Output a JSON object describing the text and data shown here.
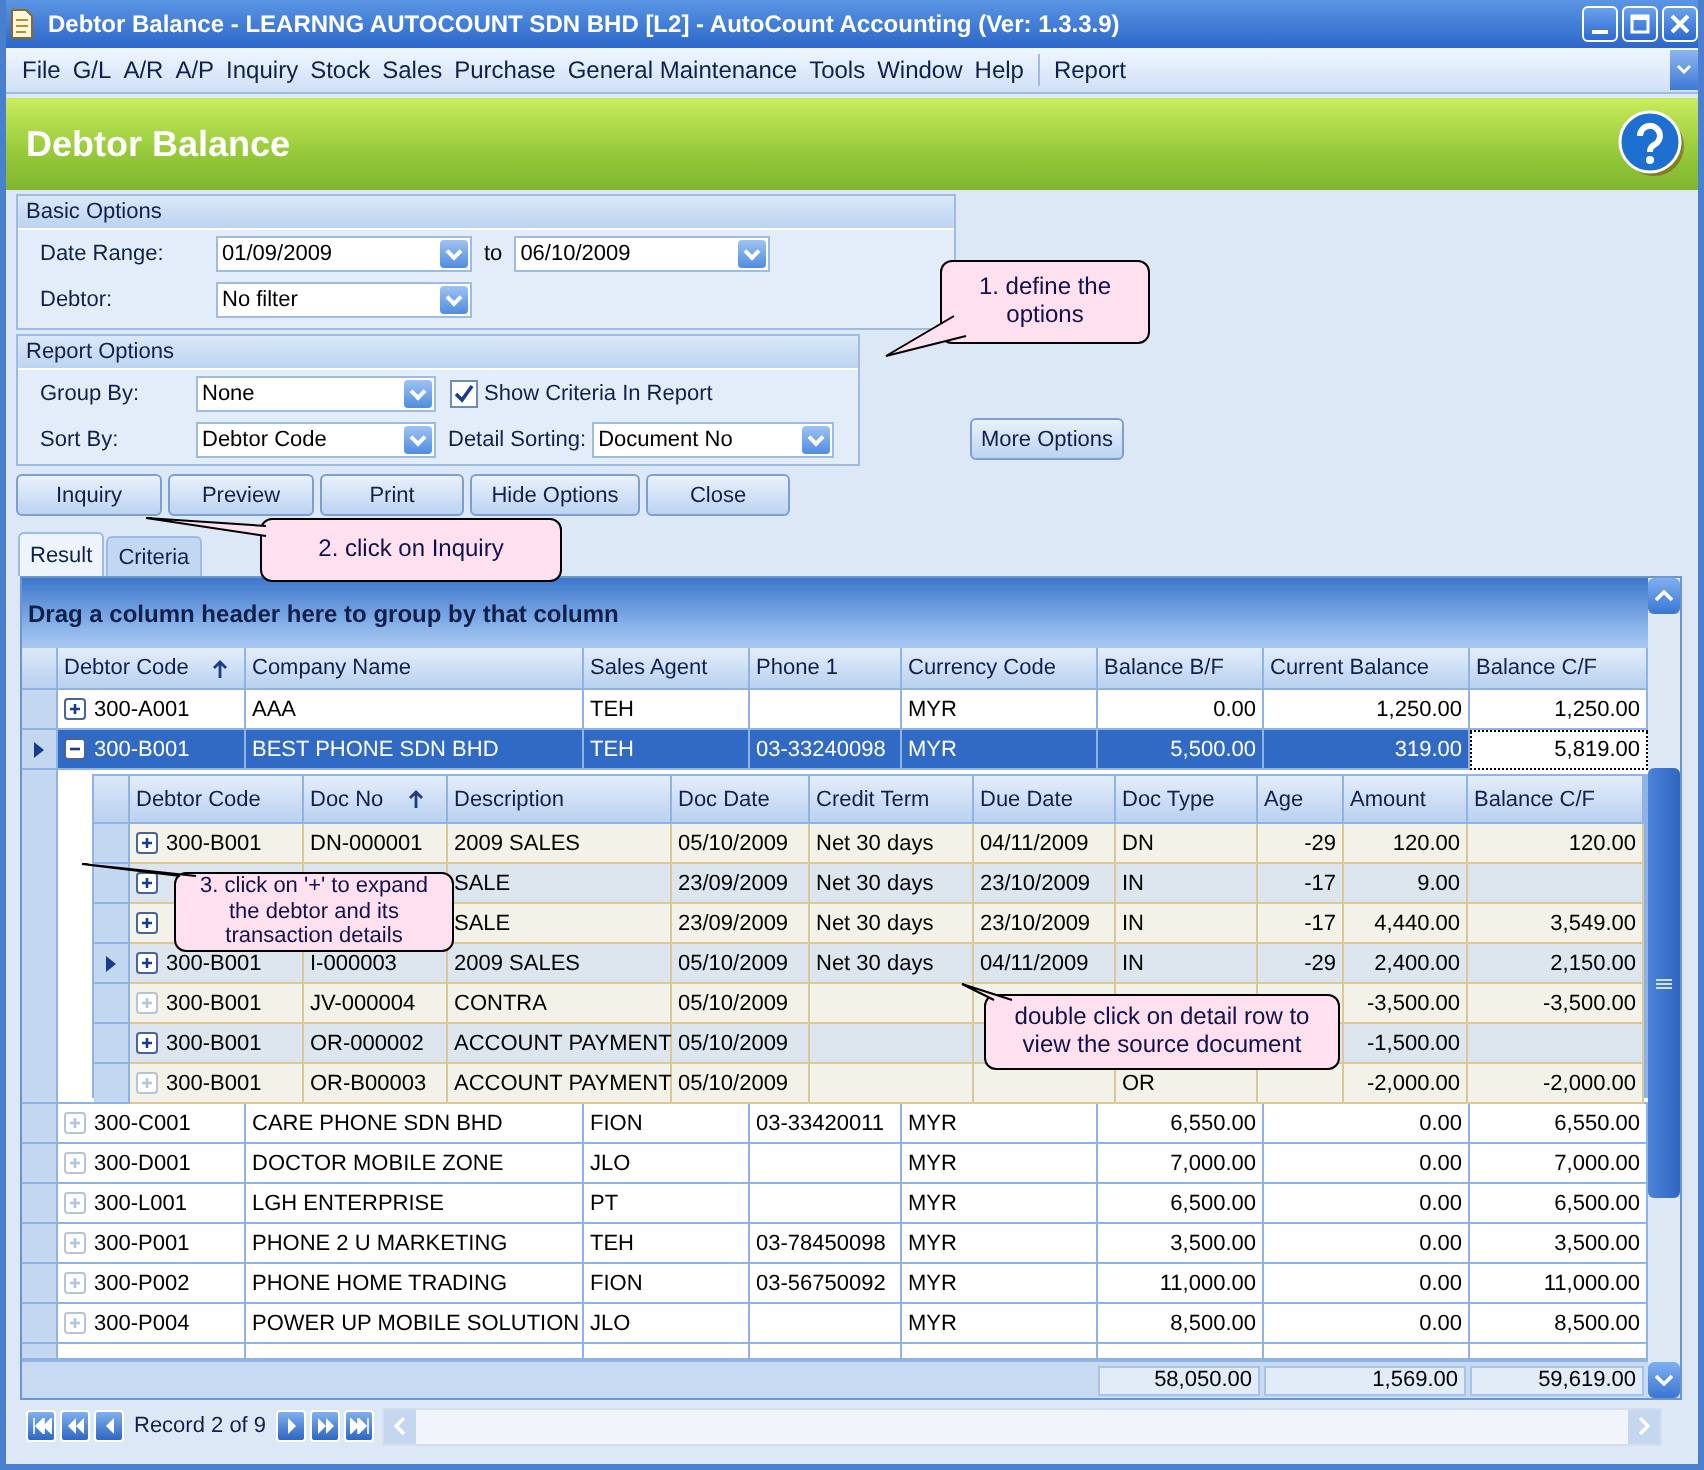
{
  "window": {
    "title": "Debtor Balance - LEARNNG AUTOCOUNT SDN BHD [L2] - AutoCount Accounting (Ver: 1.3.3.9)"
  },
  "menu": [
    "File",
    "G/L",
    "A/R",
    "A/P",
    "Inquiry",
    "Stock",
    "Sales",
    "Purchase",
    "General Maintenance",
    "Tools",
    "Window",
    "Help",
    "Report"
  ],
  "header": {
    "title": "Debtor Balance"
  },
  "basic_options": {
    "title": "Basic Options",
    "date_label": "Date Range:",
    "date_from": "01/09/2009",
    "date_separator": "to",
    "date_to": "06/10/2009",
    "debtor_label": "Debtor:",
    "debtor_value": "No filter"
  },
  "report_options": {
    "title": "Report Options",
    "group_label": "Group By:",
    "group_value": "None",
    "show_criteria": {
      "label": "Show Criteria In Report",
      "checked": true
    },
    "sort_label": "Sort By:",
    "sort_value": "Debtor Code",
    "detail_label": "Detail Sorting:",
    "detail_value": "Document No"
  },
  "more_options": "More Options",
  "buttons": [
    "Inquiry",
    "Preview",
    "Print",
    "Hide Options",
    "Close"
  ],
  "tabs": [
    {
      "label": "Result",
      "selected": true
    },
    {
      "label": "Criteria",
      "selected": false
    }
  ],
  "grid": {
    "group_hint": "Drag a column header here to group by that column",
    "columns": [
      "Debtor Code",
      "Company Name",
      "Sales Agent",
      "Phone 1",
      "Currency Code",
      "Balance B/F",
      "Current Balance",
      "Balance C/F"
    ],
    "rows_before": [
      {
        "cells": [
          "300-A001",
          "AAA",
          "TEH",
          "",
          "MYR",
          "0.00",
          "1,250.00",
          "1,250.00"
        ],
        "expanded": false,
        "has_details": true,
        "selected": false
      },
      {
        "cells": [
          "300-B001",
          "BEST PHONE SDN BHD",
          "TEH",
          "03-33240098",
          "MYR",
          "5,500.00",
          "319.00",
          "5,819.00"
        ],
        "expanded": true,
        "has_details": true,
        "selected": true
      }
    ],
    "detail": {
      "columns": [
        "Debtor Code",
        "Doc No",
        "Description",
        "Doc Date",
        "Credit Term",
        "Due Date",
        "Doc Type",
        "Age",
        "Amount",
        "Balance C/F"
      ],
      "rows": [
        {
          "cells": [
            "300-B001",
            "DN-000001",
            "2009 SALES",
            "05/10/2009",
            "Net 30 days",
            "04/11/2009",
            "DN",
            "-29",
            "120.00",
            "120.00"
          ],
          "has_details": true,
          "current": false
        },
        {
          "cells": [
            "",
            "",
            "SALE",
            "23/09/2009",
            "Net 30 days",
            "23/10/2009",
            "IN",
            "-17",
            "9.00",
            ""
          ],
          "has_details": true,
          "current": false
        },
        {
          "cells": [
            "",
            "",
            "SALE",
            "23/09/2009",
            "Net 30 days",
            "23/10/2009",
            "IN",
            "-17",
            "4,440.00",
            "3,549.00"
          ],
          "has_details": true,
          "current": false
        },
        {
          "cells": [
            "300-B001",
            "I-000003",
            "2009 SALES",
            "05/10/2009",
            "Net 30 days",
            "04/11/2009",
            "IN",
            "-29",
            "2,400.00",
            "2,150.00"
          ],
          "has_details": true,
          "current": true
        },
        {
          "cells": [
            "300-B001",
            "JV-000004",
            "CONTRA",
            "05/10/2009",
            "",
            "",
            "",
            "",
            "-3,500.00",
            "-3,500.00"
          ],
          "has_details": false,
          "current": false
        },
        {
          "cells": [
            "300-B001",
            "OR-000002",
            "ACCOUNT PAYMENT",
            "05/10/2009",
            "",
            "",
            "",
            "",
            "-1,500.00",
            ""
          ],
          "has_details": true,
          "current": false
        },
        {
          "cells": [
            "300-B001",
            "OR-B00003",
            "ACCOUNT PAYMENT",
            "05/10/2009",
            "",
            "",
            "OR",
            "",
            "-2,000.00",
            "-2,000.00"
          ],
          "has_details": false,
          "current": false
        }
      ]
    },
    "rows_after": [
      {
        "cells": [
          "300-C001",
          "CARE PHONE SDN BHD",
          "FION",
          "03-33420011",
          "MYR",
          "6,550.00",
          "0.00",
          "6,550.00"
        ],
        "expanded": false,
        "has_details": false,
        "selected": false
      },
      {
        "cells": [
          "300-D001",
          "DOCTOR MOBILE ZONE",
          "JLO",
          "",
          "MYR",
          "7,000.00",
          "0.00",
          "7,000.00"
        ],
        "expanded": false,
        "has_details": false,
        "selected": false
      },
      {
        "cells": [
          "300-L001",
          "LGH ENTERPRISE",
          "PT",
          "",
          "MYR",
          "6,500.00",
          "0.00",
          "6,500.00"
        ],
        "expanded": false,
        "has_details": false,
        "selected": false
      },
      {
        "cells": [
          "300-P001",
          "PHONE 2 U MARKETING",
          "TEH",
          "03-78450098",
          "MYR",
          "3,500.00",
          "0.00",
          "3,500.00"
        ],
        "expanded": false,
        "has_details": false,
        "selected": false
      },
      {
        "cells": [
          "300-P002",
          "PHONE HOME TRADING",
          "FION",
          "03-56750092",
          "MYR",
          "11,000.00",
          "0.00",
          "11,000.00"
        ],
        "expanded": false,
        "has_details": false,
        "selected": false
      },
      {
        "cells": [
          "300-P004",
          "POWER UP MOBILE SOLUTION",
          "JLO",
          "",
          "MYR",
          "8,500.00",
          "0.00",
          "8,500.00"
        ],
        "expanded": false,
        "has_details": false,
        "selected": false
      }
    ],
    "totals": [
      "58,050.00",
      "1,569.00",
      "59,619.00"
    ]
  },
  "navigator": {
    "record": "Record 2 of 9"
  },
  "callouts": [
    "1. define the options",
    "2. click on Inquiry",
    "3. click on '+' to expand the debtor and its transaction details",
    "double click on detail row to view the source document"
  ]
}
